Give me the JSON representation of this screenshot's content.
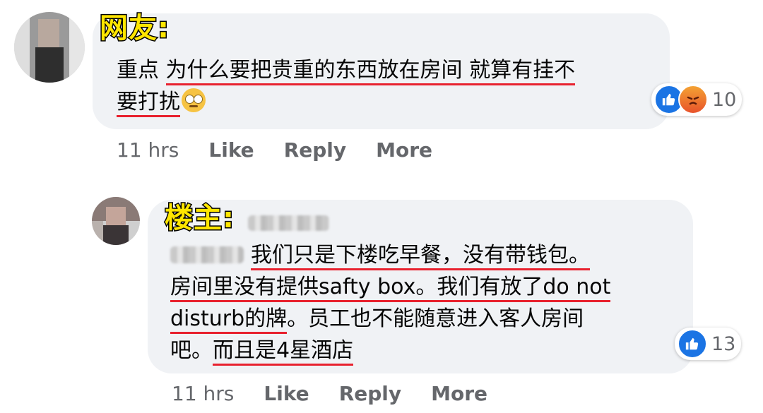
{
  "comments": [
    {
      "tag": "网友:",
      "lines": [
        {
          "plain": "重点 ",
          "underlined": "为什么要把贵重的东西放在房间 就算有挂不"
        },
        {
          "plain": "",
          "underlined": "要打扰"
        }
      ],
      "emoji_icon": "rolling-eyes-icon",
      "reaction_count": "10",
      "reactions": [
        "like-icon",
        "angry-icon"
      ],
      "time": "11 hrs",
      "actions": [
        "Like",
        "Reply",
        "More"
      ]
    },
    {
      "tag": "楼主:",
      "lines": [
        {
          "plain": "",
          "underlined": "我们只是下楼吃早餐，没有带钱包。"
        },
        {
          "plain": "",
          "underlined": "房间里没有提供safty box。我们有放了do not"
        },
        {
          "plain": "",
          "underlined": "disturb的牌",
          "tail": "。员工也不能随意进入客人房间"
        },
        {
          "plain": "吧。",
          "underlined": "而且是4星酒店"
        }
      ],
      "reaction_count": "13",
      "reactions": [
        "like-icon"
      ],
      "time": "11 hrs",
      "actions": [
        "Like",
        "Reply",
        "More"
      ]
    }
  ],
  "colors": {
    "bubble": "#f0f2f5",
    "underline": "#e8212e",
    "tag": "#ffe600",
    "like": "#1b74e4",
    "meta": "#65676b"
  }
}
